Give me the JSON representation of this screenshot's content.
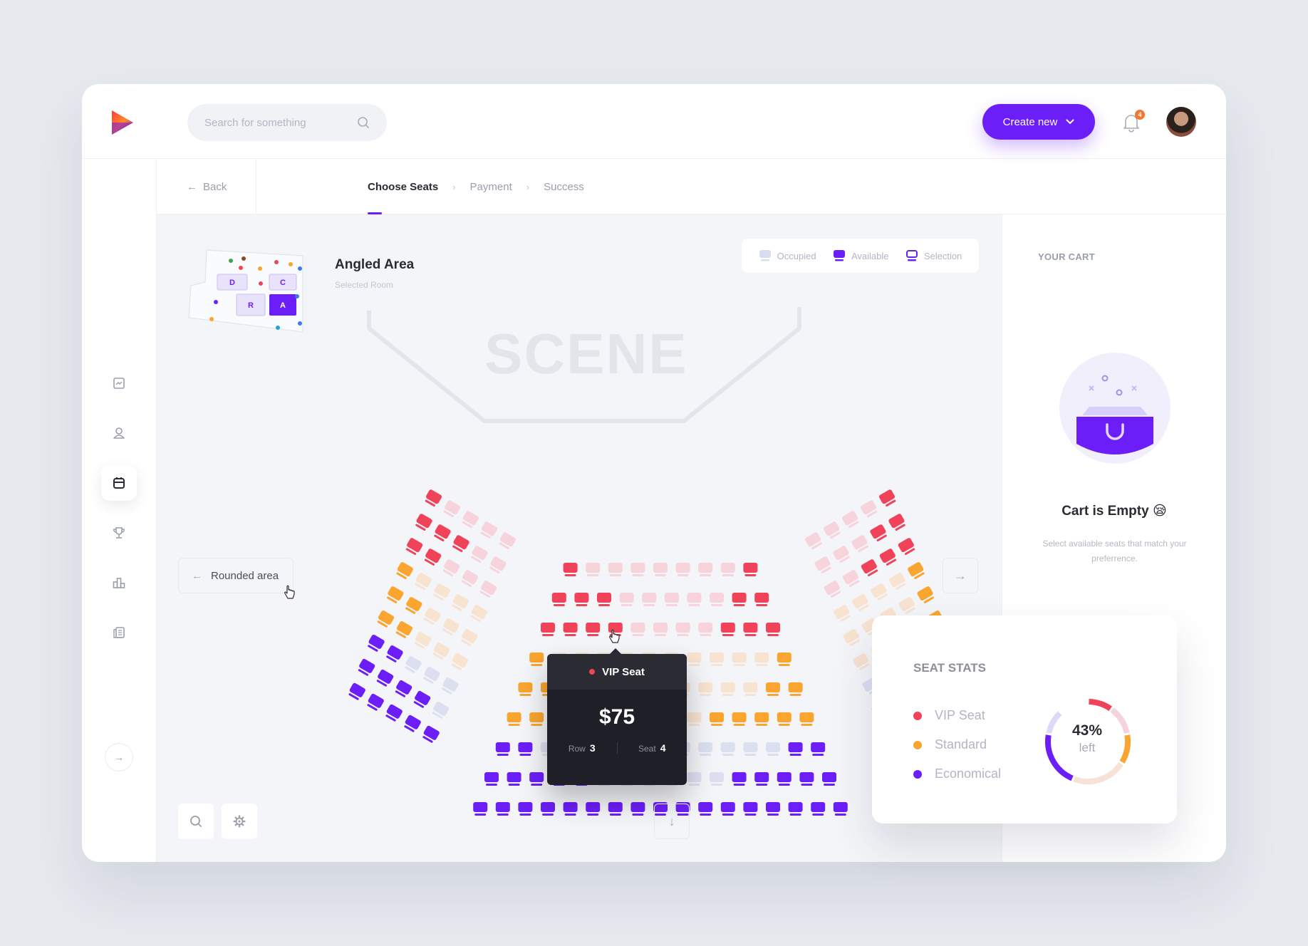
{
  "header": {
    "search_placeholder": "Search for something",
    "create_label": "Create new",
    "notifications_count": "4"
  },
  "sidebar": {
    "items": [
      {
        "icon": "chart-icon",
        "active": false
      },
      {
        "icon": "user-icon",
        "active": false
      },
      {
        "icon": "calendar-icon",
        "active": true
      },
      {
        "icon": "trophy-icon",
        "active": false
      },
      {
        "icon": "podium-icon",
        "active": false
      },
      {
        "icon": "document-icon",
        "active": false
      }
    ],
    "collapse_icon": "arrow-right-icon"
  },
  "breadcrumb": {
    "back_label": "Back",
    "steps": [
      {
        "label": "Choose Seats",
        "active": true
      },
      {
        "label": "Payment",
        "active": false
      },
      {
        "label": "Success",
        "active": false
      }
    ]
  },
  "room": {
    "title": "Angled Area",
    "subtitle": "Selected Room",
    "minimap_sections": [
      "D",
      "C",
      "R",
      "A"
    ],
    "selected_section": "A"
  },
  "legend": [
    {
      "label": "Occupied",
      "color": "#d9dcef"
    },
    {
      "label": "Available",
      "color": "#6c1ef8"
    },
    {
      "label": "Selection",
      "color": "#6c1ef8"
    }
  ],
  "stage_label": "SCENE",
  "nav": {
    "prev_area_label": "Rounded area",
    "next_area_icon": "arrow-right-icon",
    "scroll_icon": "arrow-down-icon"
  },
  "colors": {
    "accent": "#6c1ef8",
    "vip": "#f0435a",
    "vip_occupied": "#f7d3dc",
    "standard": "#f9a530",
    "standard_occupied": "#f8e2d0",
    "economical": "#6c1ef8",
    "economical_occupied": "#dcdff0"
  },
  "seating": {
    "center_rows": [
      {
        "row": 1,
        "cls": "vip",
        "seats": "AOOOOOOOA"
      },
      {
        "row": 2,
        "cls": "vip",
        "seats": "AAAOOOOOAA"
      },
      {
        "row": 3,
        "cls": "vip",
        "seats": "AAAAOOOOAAA"
      },
      {
        "row": 4,
        "cls": "standard",
        "seats": "AOOOOOOOOOOA"
      },
      {
        "row": 5,
        "cls": "standard",
        "seats": "AAOOOOOOOOOAA"
      },
      {
        "row": 6,
        "cls": "standard",
        "seats": "AAOOOOOOOAAAAA"
      },
      {
        "row": 7,
        "cls": "economical",
        "seats": "AAOOOOOOOOOOOAA"
      },
      {
        "row": 8,
        "cls": "economical",
        "seats": "AAAAAOOOOOOAAAAA"
      },
      {
        "row": 9,
        "cls": "economical",
        "seats": "AAAAAAAAAAAAAAAAA"
      }
    ],
    "left_rows": [
      {
        "cls": "vip",
        "seats": "AOOOO"
      },
      {
        "cls": "vip",
        "seats": "AAAOO"
      },
      {
        "cls": "vip",
        "seats": "AAOOO"
      },
      {
        "cls": "standard",
        "seats": "AOOOO"
      },
      {
        "cls": "standard",
        "seats": "AAOOO"
      },
      {
        "cls": "standard",
        "seats": "AAOOO"
      },
      {
        "cls": "economical",
        "seats": "AAOOO"
      },
      {
        "cls": "economical",
        "seats": "AAAAO"
      },
      {
        "cls": "economical",
        "seats": "AAAAA"
      }
    ],
    "right_rows": [
      {
        "cls": "vip",
        "seats": "AOOOO"
      },
      {
        "cls": "vip",
        "seats": "AAOOO"
      },
      {
        "cls": "vip",
        "seats": "AAAOO"
      },
      {
        "cls": "standard",
        "seats": "AOOOO"
      },
      {
        "cls": "standard",
        "seats": "AOOOO"
      },
      {
        "cls": "standard",
        "seats": "AAOOO"
      },
      {
        "cls": "economical",
        "seats": "AAAOO"
      },
      {
        "cls": "economical",
        "seats": "AAAAA"
      },
      {
        "cls": "economical",
        "seats": "AAAAA"
      }
    ]
  },
  "tooltip": {
    "type": "VIP Seat",
    "price": "$75",
    "row_label": "Row",
    "row_value": "3",
    "seat_label": "Seat",
    "seat_value": "4"
  },
  "cart": {
    "title": "YOUR CART",
    "empty_title": "Cart is Empty 😪",
    "empty_desc": "Select available seats that match your preferrence."
  },
  "seat_stats": {
    "title": "SEAT STATS",
    "categories": [
      {
        "label": "VIP Seat",
        "color": "#f0435a"
      },
      {
        "label": "Standard",
        "color": "#f9a530"
      },
      {
        "label": "Economical",
        "color": "#6c1ef8"
      }
    ],
    "percent_left": "43%",
    "left_label": "left",
    "donut_segments": [
      {
        "category": "VIP Seat",
        "status": "available",
        "fraction": 0.1,
        "color": "#f0435a"
      },
      {
        "category": "VIP Seat",
        "status": "occupied",
        "fraction": 0.12,
        "color": "#f5d2dc"
      },
      {
        "category": "Standard",
        "status": "available",
        "fraction": 0.12,
        "color": "#f9a530"
      },
      {
        "category": "Standard",
        "status": "occupied",
        "fraction": 0.22,
        "color": "#f6e2d6"
      },
      {
        "category": "Economical",
        "status": "available",
        "fraction": 0.22,
        "color": "#6c1ef8"
      },
      {
        "category": "Economical",
        "status": "occupied",
        "fraction": 0.1,
        "color": "#dcdaf8"
      }
    ]
  }
}
